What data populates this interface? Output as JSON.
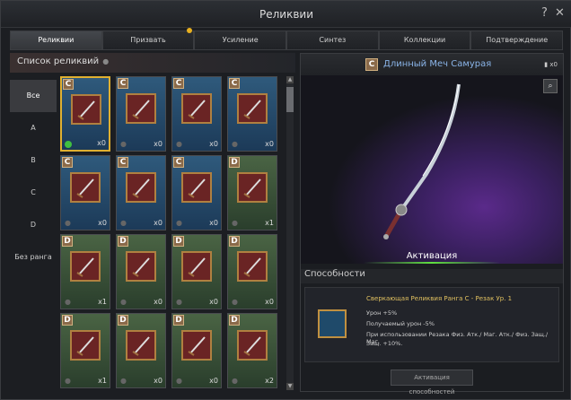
{
  "window": {
    "title": "Реликвии",
    "help": "?",
    "close": "✕"
  },
  "tabs": [
    "Реликвии",
    "Призвать",
    "Усиление",
    "Синтез",
    "Коллекции",
    "Подтверждение"
  ],
  "list": {
    "header": "Список реликвий",
    "header_dot": "●"
  },
  "filters": [
    "Все",
    "A",
    "B",
    "C",
    "D",
    "Без ранга"
  ],
  "cells": [
    {
      "rank": "C",
      "qty": "x0",
      "color": "blue"
    },
    {
      "rank": "C",
      "qty": "x0",
      "color": "blue"
    },
    {
      "rank": "C",
      "qty": "x0",
      "color": "blue"
    },
    {
      "rank": "C",
      "qty": "x0",
      "color": "blue"
    },
    {
      "rank": "C",
      "qty": "x0",
      "color": "blue"
    },
    {
      "rank": "C",
      "qty": "x0",
      "color": "blue"
    },
    {
      "rank": "C",
      "qty": "x0",
      "color": "blue"
    },
    {
      "rank": "D",
      "qty": "x1",
      "color": "green"
    },
    {
      "rank": "D",
      "qty": "x1",
      "color": "green"
    },
    {
      "rank": "D",
      "qty": "x0",
      "color": "green"
    },
    {
      "rank": "D",
      "qty": "x0",
      "color": "green"
    },
    {
      "rank": "D",
      "qty": "x0",
      "color": "green"
    },
    {
      "rank": "D",
      "qty": "x1",
      "color": "green"
    },
    {
      "rank": "D",
      "qty": "x0",
      "color": "green"
    },
    {
      "rank": "D",
      "qty": "x0",
      "color": "green"
    },
    {
      "rank": "D",
      "qty": "x2",
      "color": "green"
    }
  ],
  "detail": {
    "rank": "C",
    "name": "Длинный Меч Самурая",
    "count": "x0",
    "activation": "Активация",
    "abilities_header": "Способности",
    "ability_title": "Сверкающая Реликвия Ранга C - Резак Ур. 1",
    "ability_lines": [
      "Урон +5%",
      "Получаемый урон -5%",
      "При использовании Резака Физ. Атк./ Маг. Атк./ Физ. Защ./ Маг.",
      "Защ. +10%."
    ],
    "activate_button": "Активация способностей"
  }
}
